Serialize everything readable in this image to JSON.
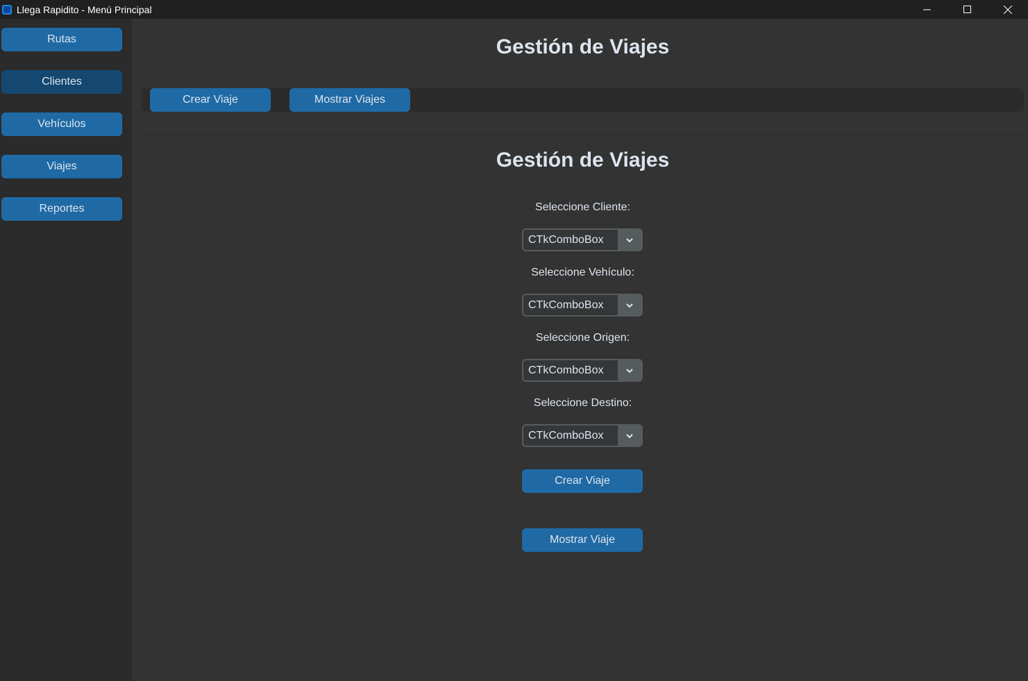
{
  "window": {
    "title": "Llega Rapidito - Menú Principal",
    "controls": [
      "minimize",
      "maximize",
      "close"
    ]
  },
  "sidebar": {
    "items": [
      {
        "label": "Rutas"
      },
      {
        "label": "Clientes"
      },
      {
        "label": "Vehículos"
      },
      {
        "label": "Viajes"
      },
      {
        "label": "Reportes"
      }
    ]
  },
  "main": {
    "title": "Gestión de Viajes",
    "tabs": [
      {
        "label": "Crear Viaje"
      },
      {
        "label": "Mostrar Viajes"
      }
    ]
  },
  "form": {
    "title": "Gestión de Viajes",
    "cliente": {
      "label": "Seleccione Cliente:",
      "value": "CTkComboBox"
    },
    "vehiculo": {
      "label": "Seleccione Vehículo:",
      "value": "CTkComboBox"
    },
    "origen": {
      "label": "Seleccione Origen:",
      "value": "CTkComboBox"
    },
    "destino": {
      "label": "Seleccione Destino:",
      "value": "CTkComboBox"
    },
    "crear_label": "Crear Viaje",
    "mostrar_label": "Mostrar Viaje"
  },
  "colors": {
    "accent": "#1f6aa5",
    "accent_active": "#144870",
    "background": "#333333",
    "sidebar": "#2b2b2b",
    "text": "#dce4ee"
  },
  "icons": {
    "app": "app-icon",
    "combo_arrow": "chevron-down-icon"
  }
}
